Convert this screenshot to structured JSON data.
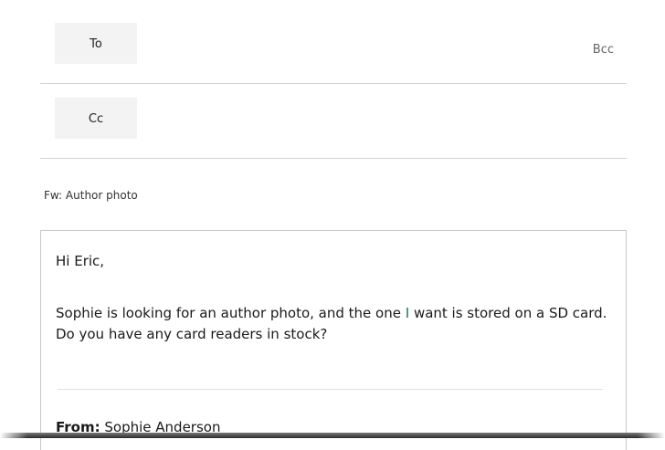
{
  "compose": {
    "to_label": "To",
    "cc_label": "Cc",
    "bcc_label": "Bcc",
    "subject": "Fw: Author photo",
    "body": {
      "greeting": "Hi Eric,",
      "paragraph_before": "Sophie is looking for an author photo, and the one ",
      "highlight_word": "I",
      "paragraph_after": " want is stored on a SD card. Do you have any card readers in stock?",
      "from_label": "From:",
      "from_value": " Sophie Anderson"
    }
  },
  "colors": {
    "button_bg": "#f3f3f3",
    "divider": "#d2d2d2",
    "highlight_word": "#1a7a4c"
  }
}
